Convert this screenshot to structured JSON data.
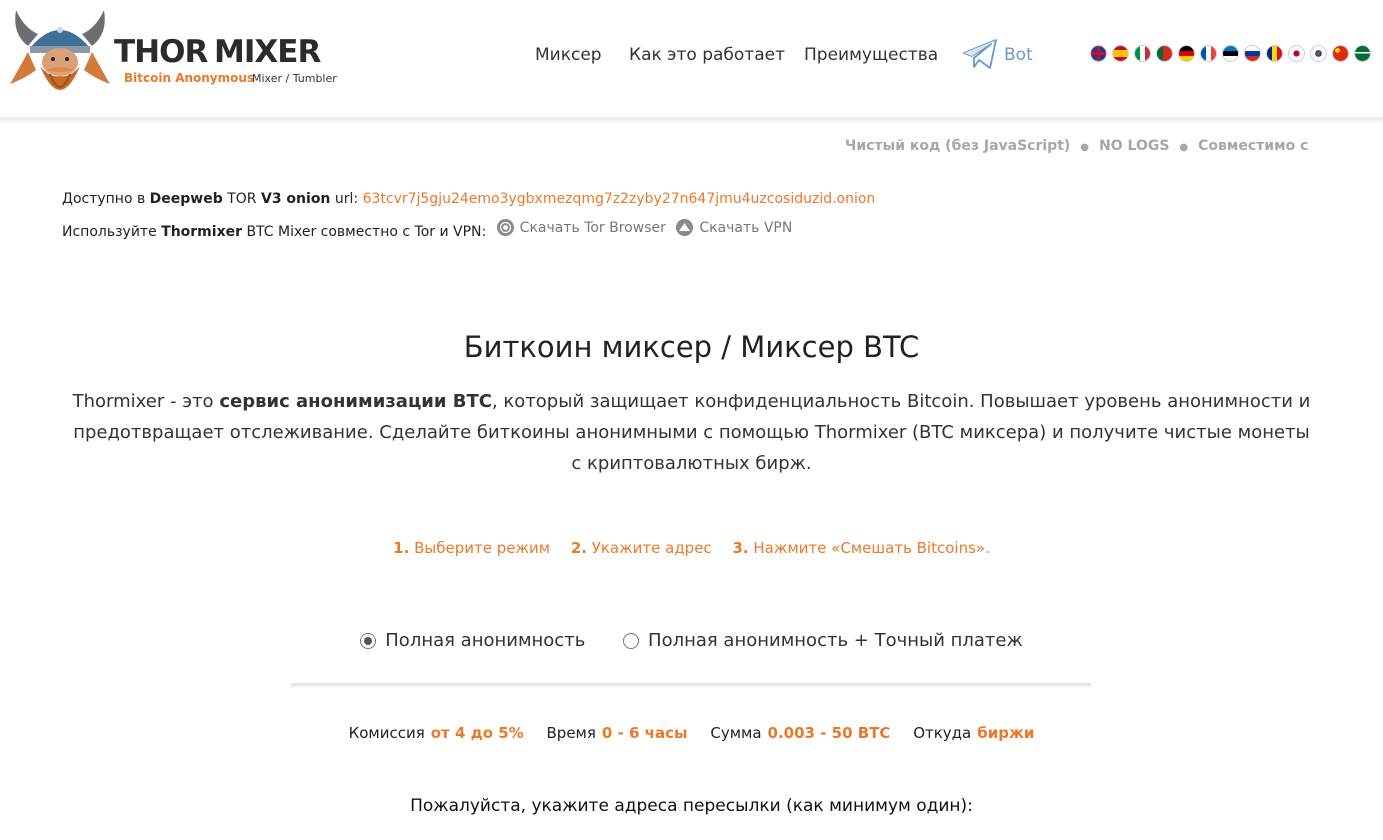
{
  "header": {
    "logo": {
      "thor": "THOR",
      "mixer": "MIXER",
      "tagline1": "Bitcoin Anonymous",
      "tagline2": "Mixer / Tumbler"
    },
    "nav": {
      "items": [
        "Миксер",
        "Как это работает",
        "Преимущества"
      ],
      "bot_label": "Bot",
      "bot_icon": "telegram-icon"
    },
    "languages": [
      "en",
      "es",
      "it",
      "pt",
      "de",
      "fr",
      "ee",
      "ru",
      "ro",
      "jp",
      "kr",
      "cn",
      "sa"
    ]
  },
  "features": [
    "Чистый код (без JavaScript)",
    "NO LOGS",
    "Совместимо с BECH"
  ],
  "info": {
    "line1_prefix": "Доступно в",
    "line1_deepweb": "Deepweb",
    "line1_tor": "TOR",
    "line1_v3": "V3 onion",
    "line1_url": "url:",
    "onion": "63tcvr7j5gju24emo3ygbxmezqmg7z2zyby27n647jmu4uzcosiduzid.onion",
    "line2_prefix": "Используйте",
    "line2_brand": "Thormixer",
    "line2_rest": "BTC Mixer совместно с Tor и VPN:",
    "tor_link": "Скачать Tor Browser",
    "vpn_link": "Скачать VPN"
  },
  "main": {
    "title": "Биткоин миксер / Миксер BTC",
    "desc_part1": "Thormixer - это",
    "desc_bold": "сервис анонимизации BTC",
    "desc_part2": ", который защищает конфиденциальность Bitcoin. Повышает уровень анонимности и предотвращает отслеживание. Сделайте биткоины анонимными с помощью Thormixer (BTC миксера) и получите чистые монеты с криптовалютных бирж."
  },
  "steps": [
    {
      "num": "1.",
      "text": "Выберите режим"
    },
    {
      "num": "2.",
      "text": "Укажите адрес"
    },
    {
      "num": "3.",
      "text": "Нажмите «Смешать Bitcoins»."
    }
  ],
  "modes": [
    {
      "label": "Полная анонимность",
      "checked": true
    },
    {
      "label": "Полная анонимность + Точный платеж",
      "checked": false
    }
  ],
  "stats": [
    {
      "label": "Комиссия",
      "value": "от 4 до 5%"
    },
    {
      "label": "Время",
      "value": "0 - 6 часы"
    },
    {
      "label": "Сумма",
      "value": "0.003 - 50 BTC"
    },
    {
      "label": "Откуда",
      "value": "биржи"
    }
  ],
  "address_prompt": "Пожалуйста, укажите адреса пересылки (как минимум один):",
  "colors": {
    "accent": "#ea7a2b",
    "bot": "#6a99c8",
    "muted": "#a7a7a7"
  }
}
